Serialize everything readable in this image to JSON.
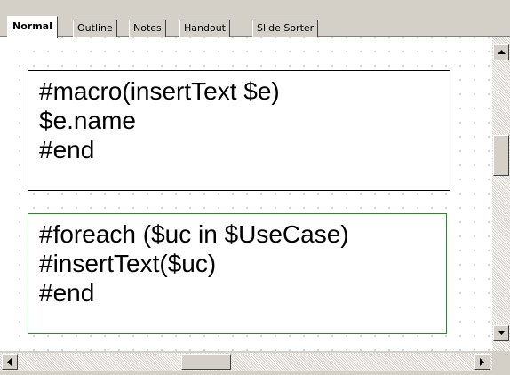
{
  "tabs": [
    {
      "label": "Normal",
      "active": true
    },
    {
      "label": "Outline",
      "active": false
    },
    {
      "label": "Notes",
      "active": false
    },
    {
      "label": "Handout",
      "active": false
    },
    {
      "label": "Slide Sorter",
      "active": false
    }
  ],
  "slide": {
    "textbox1": {
      "lines": [
        "#macro(insertText $e)",
        "$e.name",
        "#end"
      ],
      "border_color": "#000000"
    },
    "textbox2": {
      "lines": [
        "#foreach ($uc in $UseCase)",
        "#insertText($uc)",
        "#end"
      ],
      "border_color": "#2a8a2a"
    }
  },
  "scrollbars": {
    "vertical": {
      "up_icon": "arrow-up-icon",
      "down_icon": "arrow-down-icon"
    },
    "horizontal": {
      "left_icon": "arrow-left-icon",
      "right_icon": "arrow-right-icon"
    }
  }
}
